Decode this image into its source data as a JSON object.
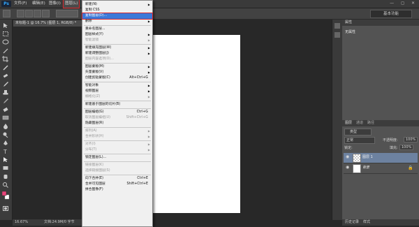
{
  "menubar": {
    "logo": "Ps",
    "items": [
      "文件(F)",
      "编辑(E)",
      "图像(I)",
      "图层(L)"
    ],
    "window_controls": "— ◻ ✕"
  },
  "optbar": {
    "workspace": "基本功能"
  },
  "doc": {
    "tab_title": "未标题-1 @ 16.7% (图层 1, RGB/8) *",
    "zoom": "16.67%",
    "doc_info": "文档:24.9M/0 字节"
  },
  "menu": {
    "items": [
      {
        "label": "新建(N)",
        "arrow": true
      },
      {
        "label": "复制 CSS"
      },
      {
        "label": "复制图层(D)...",
        "highlight": true
      },
      {
        "label": "删除",
        "arrow": true
      },
      {
        "sep": true
      },
      {
        "label": "重命名图层..."
      },
      {
        "label": "图层样式(Y)",
        "arrow": true
      },
      {
        "label": "智能滤镜",
        "disabled": true,
        "arrow": true
      },
      {
        "sep": true
      },
      {
        "label": "新建填充图层(W)",
        "arrow": true
      },
      {
        "label": "新建调整图层(J)",
        "arrow": true
      },
      {
        "label": "图层内容选项(O)...",
        "disabled": true
      },
      {
        "sep": true
      },
      {
        "label": "图层蒙版(M)",
        "arrow": true
      },
      {
        "label": "矢量蒙版(V)",
        "arrow": true
      },
      {
        "label": "创建剪贴蒙版(C)",
        "shortcut": "Alt+Ctrl+G"
      },
      {
        "sep": true
      },
      {
        "label": "智能对象",
        "arrow": true
      },
      {
        "label": "视频图层",
        "arrow": true
      },
      {
        "label": "栅格化(Z)",
        "disabled": true,
        "arrow": true
      },
      {
        "sep": true
      },
      {
        "label": "新建基于图层的切片(B)"
      },
      {
        "sep": true
      },
      {
        "label": "图层编组(G)",
        "shortcut": "Ctrl+G"
      },
      {
        "label": "取消图层编组(U)",
        "shortcut": "Shift+Ctrl+G",
        "disabled": true
      },
      {
        "label": "隐藏图层(R)"
      },
      {
        "sep": true
      },
      {
        "label": "排列(A)",
        "disabled": true,
        "arrow": true
      },
      {
        "label": "合并形状(H)",
        "disabled": true,
        "arrow": true
      },
      {
        "sep": true
      },
      {
        "label": "对齐(I)",
        "disabled": true,
        "arrow": true
      },
      {
        "label": "分布(T)",
        "disabled": true,
        "arrow": true
      },
      {
        "sep": true
      },
      {
        "label": "锁定图层(L)..."
      },
      {
        "sep": true
      },
      {
        "label": "链接图层(K)",
        "disabled": true
      },
      {
        "label": "选择链接图层(S)",
        "disabled": true
      },
      {
        "sep": true
      },
      {
        "label": "向下合并(E)",
        "shortcut": "Ctrl+E"
      },
      {
        "label": "合并可见图层",
        "shortcut": "Shift+Ctrl+E"
      },
      {
        "label": "拼合图像(F)"
      }
    ]
  },
  "panel": {
    "properties_tab": "属性",
    "properties_msg": "无属性",
    "layers_tab": "图层",
    "channels_tab": "通道",
    "paths_tab": "路径",
    "kind_filter": "类型",
    "blend_mode": "正常",
    "opacity_label": "不透明度:",
    "opacity_value": "100%",
    "lock_label": "锁定:",
    "fill_label": "填充:",
    "fill_value": "100%",
    "layers": [
      {
        "name": "图层 1",
        "selected": true
      },
      {
        "name": "背景",
        "locked": true
      }
    ],
    "bottom_tabs": [
      "历史记录",
      "样式"
    ]
  },
  "colors": {
    "accent_red": "#d8262a",
    "highlight_blue": "#3c78d8",
    "ps_blue": "#31a8ff"
  }
}
